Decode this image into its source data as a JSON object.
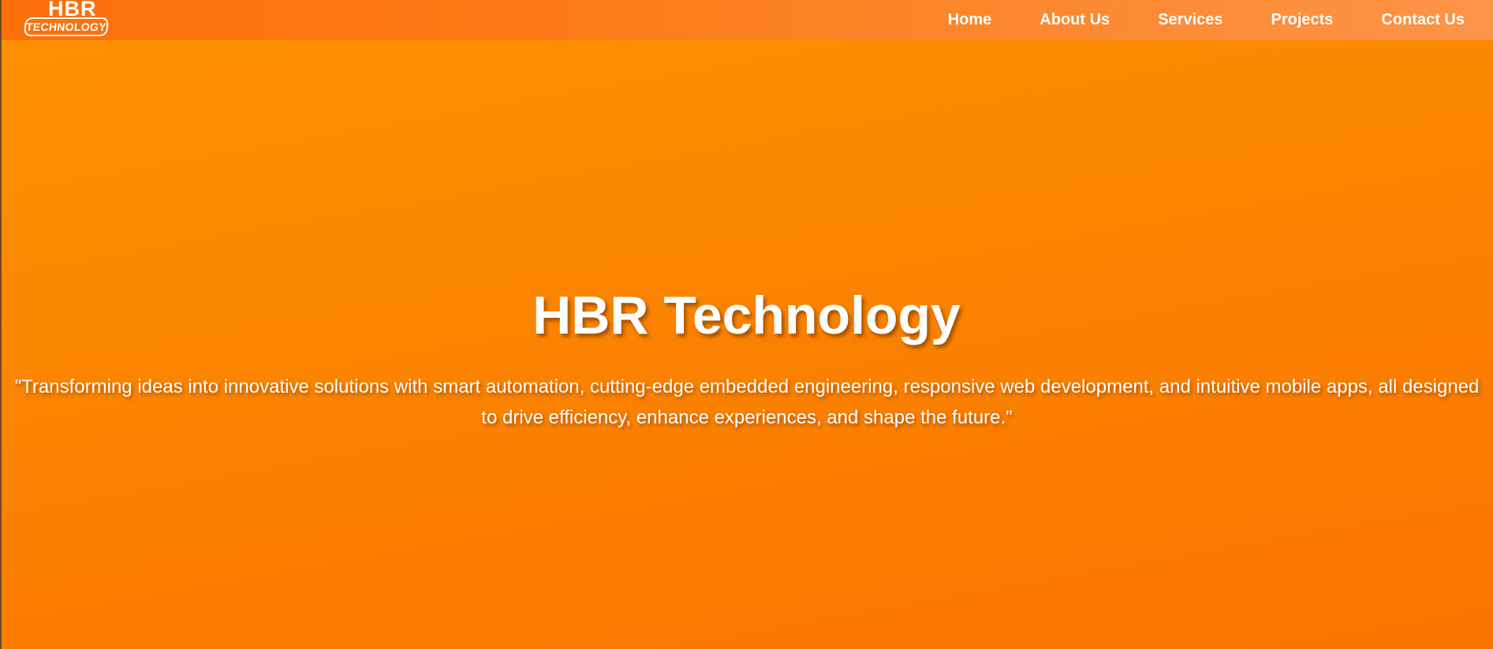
{
  "brand": {
    "logo_top": "HBR",
    "logo_bottom": "TECHNOLOGY"
  },
  "nav": {
    "items": [
      {
        "label": "Home"
      },
      {
        "label": "About Us"
      },
      {
        "label": "Services"
      },
      {
        "label": "Projects"
      },
      {
        "label": "Contact Us"
      }
    ]
  },
  "hero": {
    "title": "HBR Technology",
    "subtitle": "\"Transforming ideas into innovative solutions with smart automation, cutting-edge embedded engineering, responsive web development, and intuitive mobile apps, all designed to drive efficiency, enhance experiences, and shape the future.\""
  },
  "colors": {
    "navbar_start": "#fc6f0a",
    "navbar_end": "#fd9448",
    "hero_top": "#fc9200",
    "hero_bottom": "#fa7400",
    "text": "#ffffff"
  }
}
